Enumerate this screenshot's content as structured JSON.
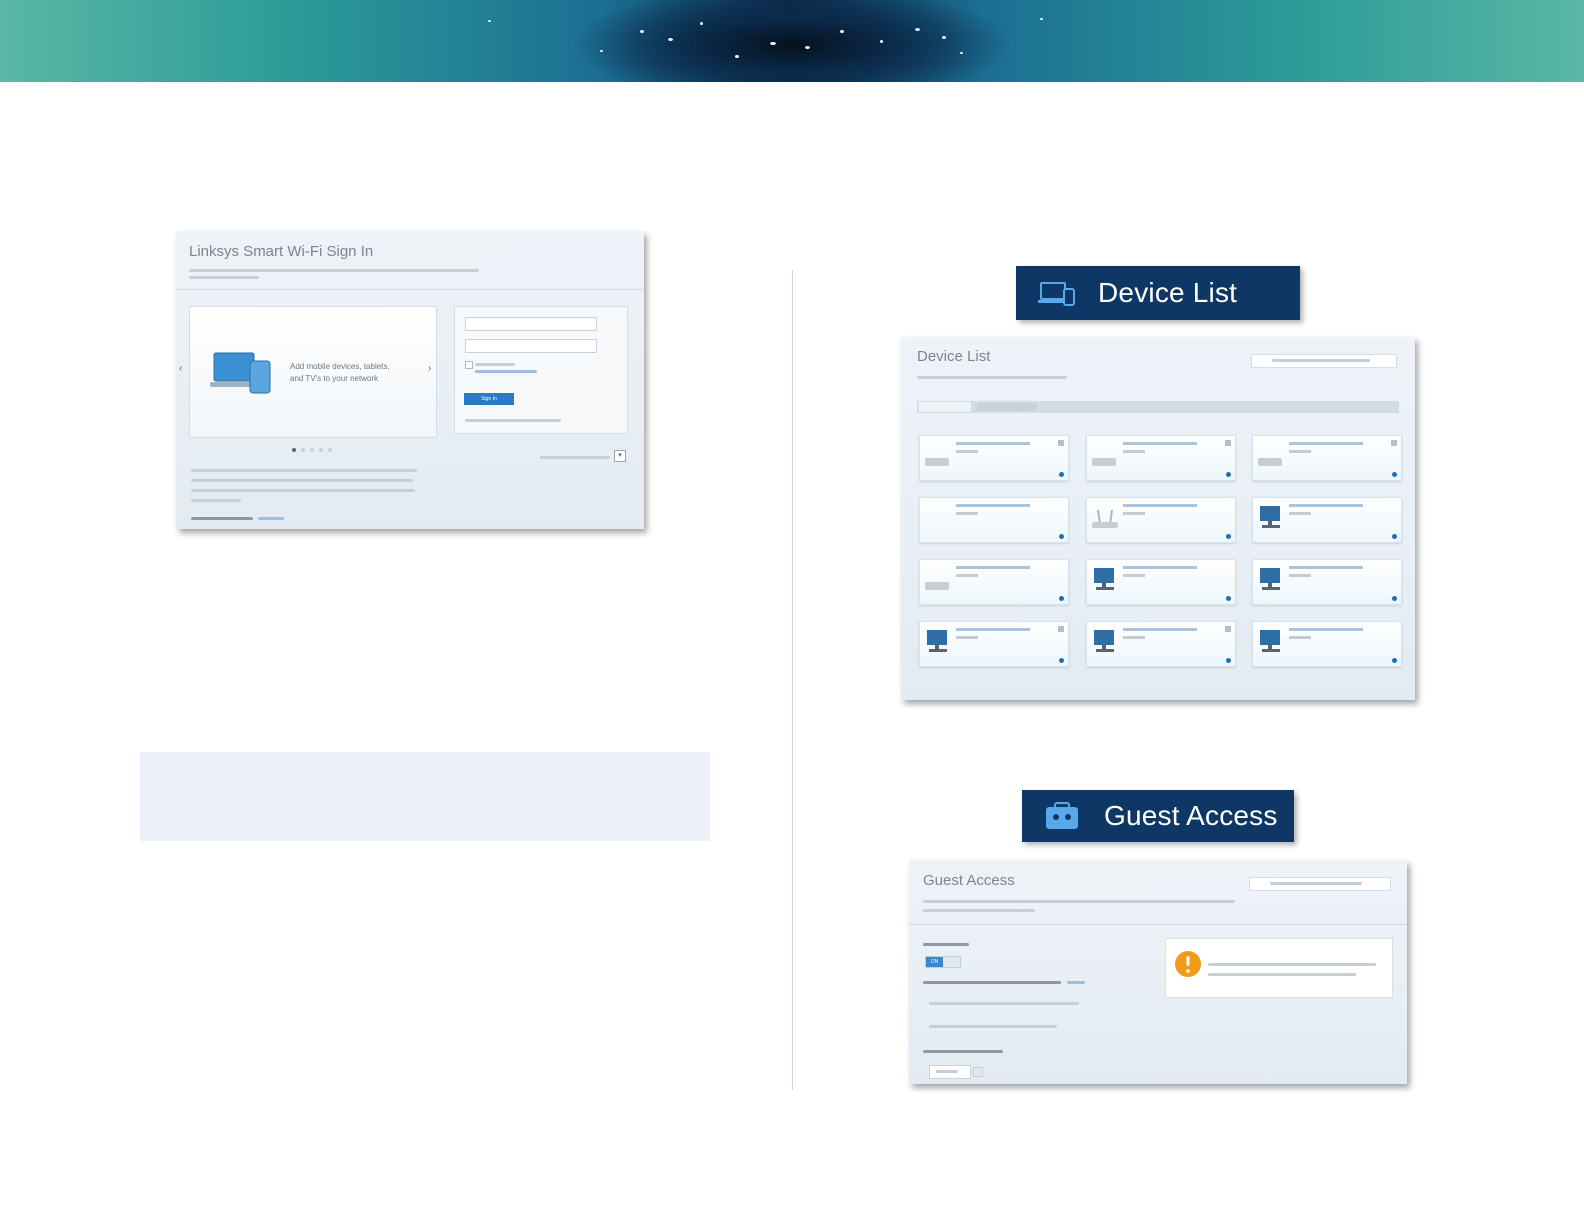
{
  "signin": {
    "title": "Linksys Smart Wi-Fi Sign In",
    "promo_text": "Add mobile devices, tablets, and TV's to your network",
    "button_label": "Sign In"
  },
  "device_list": {
    "header_label": "Device List",
    "screenshot_title": "Device List"
  },
  "guest_access": {
    "header_label": "Guest Access",
    "screenshot_title": "Guest Access",
    "toggle_label": "ON"
  }
}
